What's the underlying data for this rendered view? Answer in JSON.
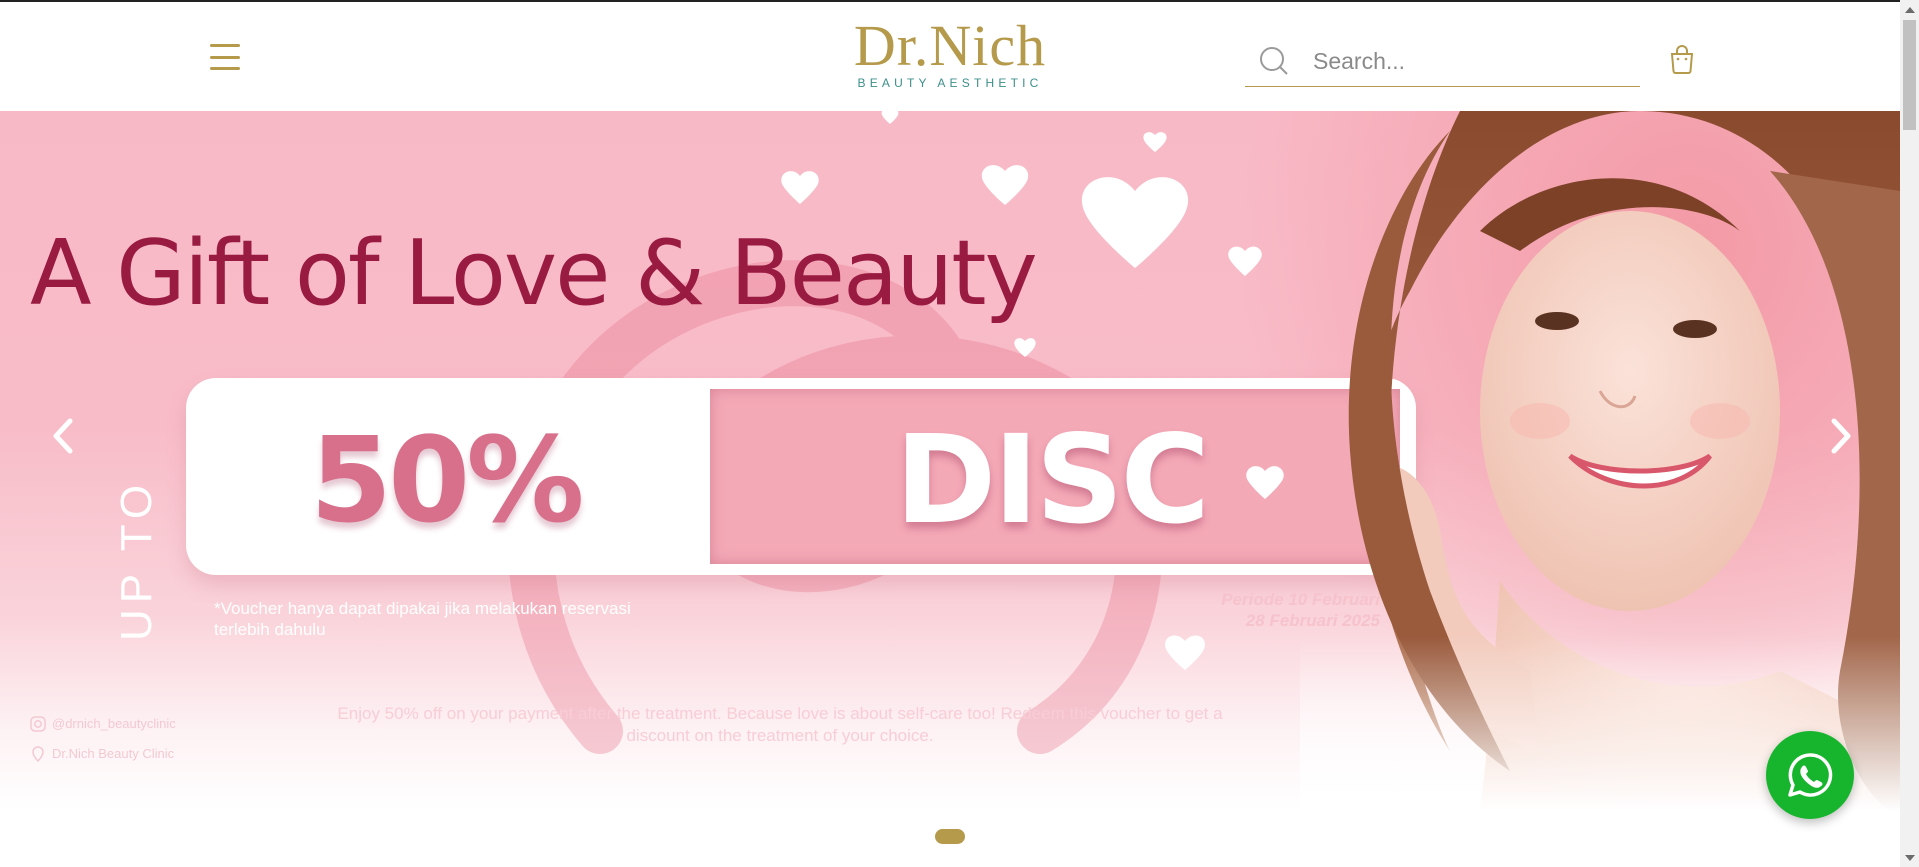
{
  "header": {
    "logo": {
      "main": "Dr.Nich",
      "sub": "BEAUTY AESTHETIC"
    },
    "search": {
      "placeholder": "Search..."
    },
    "icons": {
      "menu": "hamburger-menu-icon",
      "search": "search-icon",
      "cart": "shopping-bag-icon"
    }
  },
  "banner": {
    "title": "A Gift of Love & Beauty",
    "up_to": "UP TO",
    "discount_value": "50%",
    "discount_word": "DISC",
    "voucher_note": "*Voucher hanya dapat dipakai jika melakukan reservasi terlebih dahulu",
    "period_line1": "Periode 10 Februari",
    "period_line2": "28 Februari 2025",
    "description": "Enjoy 50% off on your payment after the treatment. Because love is about self-care too! Redeem this voucher to get a discount on the treatment of your choice.",
    "instagram": "@drnich_beautyclinic",
    "location": "Dr.Nich Beauty Clinic"
  },
  "carousel": {
    "total_slides": 1,
    "active_slide": 1
  },
  "colors": {
    "brand_gold": "#b59a4b",
    "brand_teal": "#3c8f8b",
    "title_crimson": "#9a1b42",
    "whatsapp": "#17b52e"
  }
}
